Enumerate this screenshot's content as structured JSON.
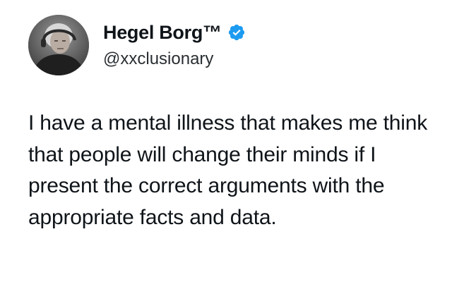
{
  "author": {
    "display_name": "Hegel Borg™",
    "handle": "@xxclusionary",
    "verified": true,
    "verified_badge_color": "#1d9bf0",
    "avatar_icon": "user-avatar-photo"
  },
  "tweet": {
    "text": "I have a mental illness that makes me think that people will change their minds if I present the correct arguments with the appropriate facts and data."
  }
}
